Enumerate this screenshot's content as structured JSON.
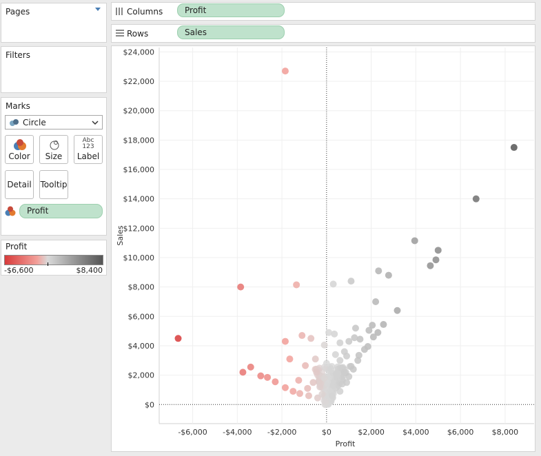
{
  "pages": {
    "title": "Pages"
  },
  "filters": {
    "title": "Filters"
  },
  "marks": {
    "title": "Marks",
    "mark_type": "Circle",
    "buttons": {
      "color": "Color",
      "size": "Size",
      "label": "Label",
      "label_icon": "Abc\n123",
      "detail": "Detail",
      "tooltip": "Tooltip"
    },
    "color_field": "Profit"
  },
  "legend": {
    "title": "Profit",
    "min_label": "-$6,600",
    "max_label": "$8,400",
    "colors": [
      "#d83b3b",
      "#f2a09a",
      "#d9d9d9",
      "#555555"
    ]
  },
  "shelves": {
    "columns": {
      "label": "Columns",
      "pill": "Profit"
    },
    "rows": {
      "label": "Rows",
      "pill": "Sales"
    }
  },
  "chart_data": {
    "type": "scatter",
    "xlabel": "Profit",
    "ylabel": "Sales",
    "xlim": [
      -7500,
      9300
    ],
    "ylim": [
      -1300,
      24300
    ],
    "x_ticks": [
      -6000,
      -4000,
      -2000,
      0,
      2000,
      4000,
      6000,
      8000
    ],
    "x_tick_labels": [
      "-$6,000",
      "-$4,000",
      "-$2,000",
      "$0",
      "$2,000",
      "$4,000",
      "$6,000",
      "$8,000"
    ],
    "y_ticks": [
      0,
      2000,
      4000,
      6000,
      8000,
      10000,
      12000,
      14000,
      16000,
      18000,
      20000,
      22000,
      24000
    ],
    "y_tick_labels": [
      "$0",
      "$2,000",
      "$4,000",
      "$6,000",
      "$8,000",
      "$10,000",
      "$12,000",
      "$14,000",
      "$16,000",
      "$18,000",
      "$20,000",
      "$22,000",
      "$24,000"
    ],
    "color_range": [
      -6600,
      8400
    ],
    "grid": true,
    "points": [
      {
        "x": 8400,
        "y": 17500
      },
      {
        "x": 6700,
        "y": 14000
      },
      {
        "x": 3950,
        "y": 11150
      },
      {
        "x": 5000,
        "y": 10500
      },
      {
        "x": 4900,
        "y": 9850
      },
      {
        "x": 4650,
        "y": 9450
      },
      {
        "x": 2330,
        "y": 9100
      },
      {
        "x": 2780,
        "y": 8800
      },
      {
        "x": 1100,
        "y": 8400
      },
      {
        "x": 300,
        "y": 8200
      },
      {
        "x": -1350,
        "y": 8150
      },
      {
        "x": -3850,
        "y": 8000
      },
      {
        "x": -1850,
        "y": 22700
      },
      {
        "x": 2200,
        "y": 7000
      },
      {
        "x": 3170,
        "y": 6400
      },
      {
        "x": -6650,
        "y": 4500
      },
      {
        "x": -3750,
        "y": 2200
      },
      {
        "x": -3400,
        "y": 2550
      },
      {
        "x": -2950,
        "y": 1950
      },
      {
        "x": -2650,
        "y": 1850
      },
      {
        "x": -2300,
        "y": 1550
      },
      {
        "x": -1850,
        "y": 1150
      },
      {
        "x": -1850,
        "y": 4300
      },
      {
        "x": -1650,
        "y": 3100
      },
      {
        "x": -1100,
        "y": 4700
      },
      {
        "x": -700,
        "y": 4500
      },
      {
        "x": -500,
        "y": 3100
      },
      {
        "x": -950,
        "y": 2650
      },
      {
        "x": -1250,
        "y": 1650
      },
      {
        "x": -1500,
        "y": 900
      },
      {
        "x": -1200,
        "y": 750
      },
      {
        "x": -800,
        "y": 600
      },
      {
        "x": -400,
        "y": 450
      },
      {
        "x": 2550,
        "y": 5450
      },
      {
        "x": 1300,
        "y": 5200
      },
      {
        "x": 1900,
        "y": 5050
      },
      {
        "x": 2300,
        "y": 4900
      },
      {
        "x": 2100,
        "y": 4600
      },
      {
        "x": 1500,
        "y": 4450
      },
      {
        "x": 1250,
        "y": 4550
      },
      {
        "x": 1850,
        "y": 3950
      },
      {
        "x": 1700,
        "y": 3750
      },
      {
        "x": 1450,
        "y": 3350
      },
      {
        "x": 1000,
        "y": 4300
      },
      {
        "x": 600,
        "y": 4200
      },
      {
        "x": 350,
        "y": 4800
      },
      {
        "x": 100,
        "y": 4900
      },
      {
        "x": -100,
        "y": 4050
      },
      {
        "x": 800,
        "y": 3600
      },
      {
        "x": 1400,
        "y": 3000
      },
      {
        "x": 1100,
        "y": 2600
      },
      {
        "x": 800,
        "y": 2200
      },
      {
        "x": 500,
        "y": 1800
      },
      {
        "x": 300,
        "y": 1300
      },
      {
        "x": 150,
        "y": 900
      },
      {
        "x": 50,
        "y": 400
      },
      {
        "x": -200,
        "y": 700
      },
      {
        "x": -100,
        "y": 1800
      },
      {
        "x": 200,
        "y": 2400
      },
      {
        "x": 600,
        "y": 3000
      },
      {
        "x": 900,
        "y": 3300
      },
      {
        "x": 400,
        "y": 3400
      },
      {
        "x": 0,
        "y": 2800
      },
      {
        "x": -300,
        "y": 1200
      },
      {
        "x": 700,
        "y": 1400
      },
      {
        "x": 1000,
        "y": 1900
      },
      {
        "x": 1200,
        "y": 2400
      },
      {
        "x": 250,
        "y": 600
      },
      {
        "x": -50,
        "y": 200
      },
      {
        "x": 600,
        "y": 900
      },
      {
        "x": 900,
        "y": 1500
      },
      {
        "x": 450,
        "y": 2000
      },
      {
        "x": -600,
        "y": 1500
      },
      {
        "x": -450,
        "y": 2200
      },
      {
        "x": -850,
        "y": 1100
      },
      {
        "x": 2050,
        "y": 5400
      }
    ]
  }
}
